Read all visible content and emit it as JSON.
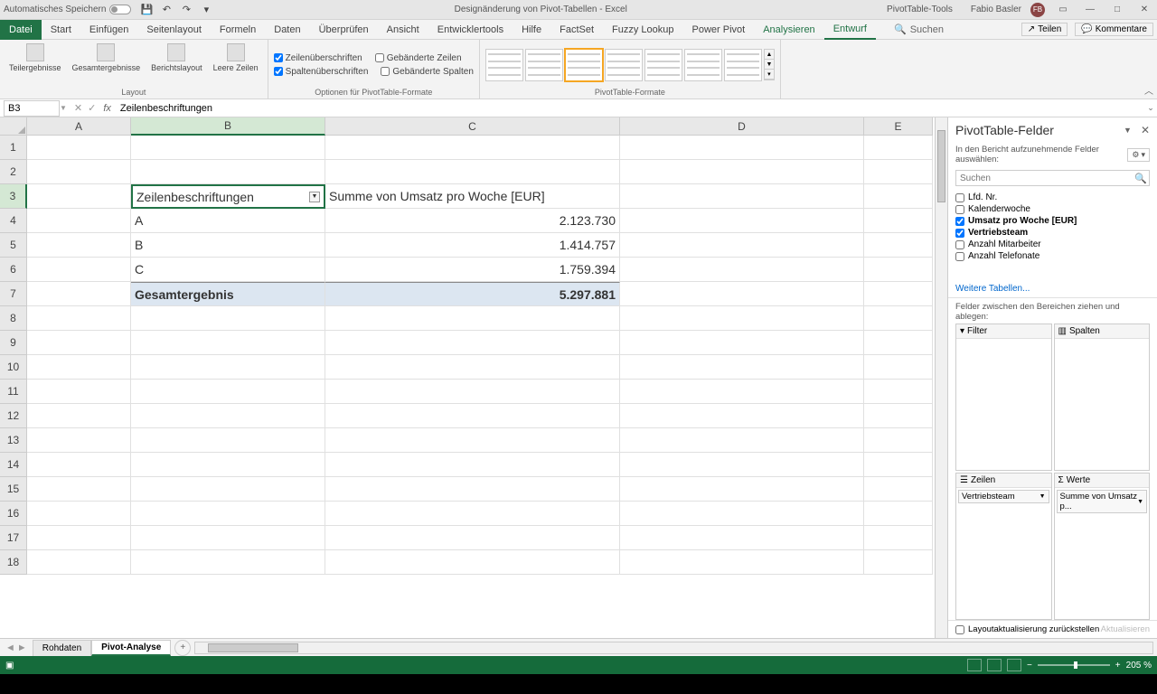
{
  "titlebar": {
    "autosave": "Automatisches Speichern",
    "title_center": "Designänderung von Pivot-Tabellen  -  Excel",
    "tools": "PivotTable-Tools",
    "user": "Fabio Basler",
    "initials": "FB"
  },
  "tabs": {
    "file": "Datei",
    "items": [
      "Start",
      "Einfügen",
      "Seitenlayout",
      "Formeln",
      "Daten",
      "Überprüfen",
      "Ansicht",
      "Entwicklertools",
      "Hilfe",
      "FactSet",
      "Fuzzy Lookup",
      "Power Pivot"
    ],
    "context1": "Analysieren",
    "context2": "Entwurf",
    "search": "Suchen",
    "share": "Teilen",
    "comments": "Kommentare"
  },
  "ribbon": {
    "layout_group": "Layout",
    "layout_btns": [
      "Teilergebnisse",
      "Gesamtergebnisse",
      "Berichtslayout",
      "Leere Zeilen"
    ],
    "options_group": "Optionen für PivotTable-Formate",
    "opt1": "Zeilenüberschriften",
    "opt2": "Spaltenüberschriften",
    "opt3": "Gebänderte Zeilen",
    "opt4": "Gebänderte Spalten",
    "styles_group": "PivotTable-Formate"
  },
  "formulabar": {
    "namebox": "B3",
    "formula": "Zeilenbeschriftungen"
  },
  "grid": {
    "cols": [
      "A",
      "B",
      "C",
      "D",
      "E"
    ],
    "header_b": "Zeilenbeschriftungen",
    "header_c": "Summe von Umsatz pro Woche [EUR]",
    "rows": [
      {
        "label": "A",
        "value": "2.123.730"
      },
      {
        "label": "B",
        "value": "1.414.757"
      },
      {
        "label": "C",
        "value": "1.759.394"
      }
    ],
    "total_label": "Gesamtergebnis",
    "total_value": "5.297.881"
  },
  "pane": {
    "title": "PivotTable-Felder",
    "subtitle": "In den Bericht aufzunehmende Felder auswählen:",
    "search_ph": "Suchen",
    "fields": [
      {
        "name": "Lfd. Nr.",
        "checked": false,
        "bold": false
      },
      {
        "name": "Kalenderwoche",
        "checked": false,
        "bold": false
      },
      {
        "name": "Umsatz pro Woche [EUR]",
        "checked": true,
        "bold": true
      },
      {
        "name": "Vertriebsteam",
        "checked": true,
        "bold": true
      },
      {
        "name": "Anzahl Mitarbeiter",
        "checked": false,
        "bold": false
      },
      {
        "name": "Anzahl Telefonate",
        "checked": false,
        "bold": false
      }
    ],
    "more": "Weitere Tabellen...",
    "areas_label": "Felder zwischen den Bereichen ziehen und ablegen:",
    "area_filter": "Filter",
    "area_cols": "Spalten",
    "area_rows": "Zeilen",
    "area_vals": "Werte",
    "row_item": "Vertriebsteam",
    "val_item": "Summe von Umsatz p...",
    "defer": "Layoutaktualisierung zurückstellen",
    "update": "Aktualisieren"
  },
  "sheets": {
    "tab1": "Rohdaten",
    "tab2": "Pivot-Analyse"
  },
  "status": {
    "zoom": "205 %"
  }
}
